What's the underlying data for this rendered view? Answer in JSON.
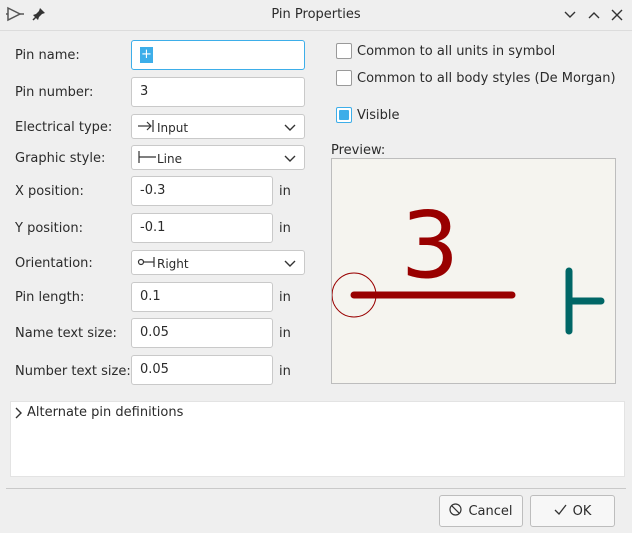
{
  "window": {
    "title": "Pin Properties"
  },
  "fields": {
    "pin_name": {
      "label": "Pin name:",
      "value": "+"
    },
    "pin_number": {
      "label": "Pin number:",
      "value": "3"
    },
    "electrical_type": {
      "label": "Electrical type:",
      "value": "Input"
    },
    "graphic_style": {
      "label": "Graphic style:",
      "value": "Line"
    },
    "x_position": {
      "label": "X position:",
      "value": "-0.3",
      "unit": "in"
    },
    "y_position": {
      "label": "Y position:",
      "value": "-0.1",
      "unit": "in"
    },
    "orientation": {
      "label": "Orientation:",
      "value": "Right"
    },
    "pin_length": {
      "label": "Pin length:",
      "value": "0.1",
      "unit": "in"
    },
    "name_text_size": {
      "label": "Name text size:",
      "value": "0.05",
      "unit": "in"
    },
    "number_text_size": {
      "label": "Number text size:",
      "value": "0.05",
      "unit": "in"
    }
  },
  "options": {
    "common_units": {
      "label": "Common to all units in symbol",
      "checked": false
    },
    "common_body_styles": {
      "label": "Common to all body styles (De Morgan)",
      "checked": false
    },
    "visible": {
      "label": "Visible",
      "checked": true
    }
  },
  "preview": {
    "label": "Preview:",
    "pin_number_text": "3",
    "pin_name_text": "+"
  },
  "alternate": {
    "label": "Alternate pin definitions"
  },
  "buttons": {
    "cancel": "Cancel",
    "ok": "OK"
  },
  "colors": {
    "accent": "#3daee9",
    "pin_color": "#990000",
    "name_color": "#006666",
    "preview_bg": "#f5f4ef"
  }
}
